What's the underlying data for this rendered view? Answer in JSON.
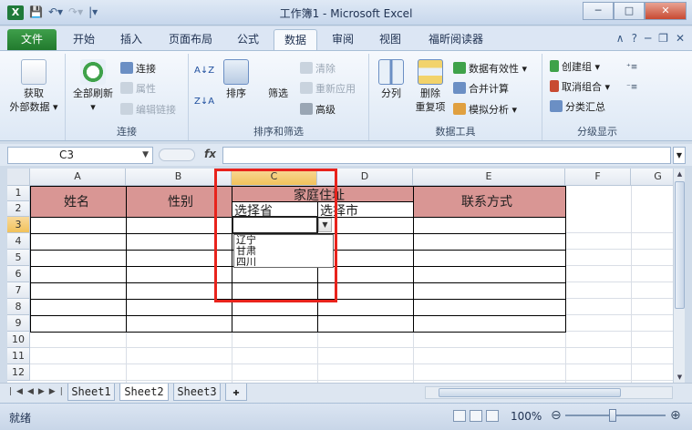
{
  "window": {
    "title": "工作簿1 - Microsoft Excel",
    "app_icon": "X",
    "qat": [
      "save-icon",
      "undo-icon",
      "redo-icon",
      "customize-icon"
    ],
    "minimize": "─",
    "maximize": "□",
    "close": "✕"
  },
  "tabs": {
    "file": "文件",
    "items": [
      "开始",
      "插入",
      "页面布局",
      "公式",
      "数据",
      "审阅",
      "视图",
      "福昕阅读器"
    ],
    "active": "数据",
    "right_icons": [
      "∧",
      "?",
      "─",
      "❐",
      "✕"
    ]
  },
  "ribbon": {
    "external_data": {
      "label": "获取",
      "label2": "外部数据 ▾"
    },
    "connections": {
      "refresh_all": "全部刷新",
      "connections": "连接",
      "properties": "属性",
      "edit_links": "编辑链接",
      "group_label": "连接"
    },
    "sort_filter": {
      "sort_az": "A↓Z",
      "sort_za": "Z↓A",
      "sort": "排序",
      "filter": "筛选",
      "clear": "清除",
      "reapply": "重新应用",
      "advanced": "高级",
      "group_label": "排序和筛选"
    },
    "data_tools": {
      "text_to_columns": "分列",
      "remove_duplicates": "删除",
      "remove_duplicates2": "重复项",
      "data_validation": "数据有效性 ▾",
      "consolidate": "合并计算",
      "what_if": "模拟分析 ▾",
      "group_label": "数据工具"
    },
    "outline": {
      "group": "创建组 ▾",
      "ungroup": "取消组合 ▾",
      "subtotal": "分类汇总",
      "group_label": "分级显示"
    }
  },
  "formula_bar": {
    "name_box": "C3",
    "fx": "fx",
    "formula": ""
  },
  "grid": {
    "columns": [
      "A",
      "B",
      "C",
      "D",
      "E",
      "F",
      "G"
    ],
    "rows": [
      "1",
      "2",
      "3",
      "4",
      "5",
      "6",
      "7",
      "8",
      "9",
      "10",
      "11",
      "12"
    ],
    "selected_column": "C",
    "selected_row": "3",
    "headers": {
      "name": "姓名",
      "gender": "性别",
      "address": "家庭住址",
      "province": "选择省",
      "city": "选择市",
      "contact": "联系方式"
    },
    "dropdown_options": [
      "辽宁",
      "甘肃",
      "四川"
    ]
  },
  "sheets": {
    "items": [
      "Sheet1",
      "Sheet2",
      "Sheet3"
    ],
    "active": "Sheet2"
  },
  "status": {
    "ready": "就绪",
    "zoom": "100%"
  }
}
